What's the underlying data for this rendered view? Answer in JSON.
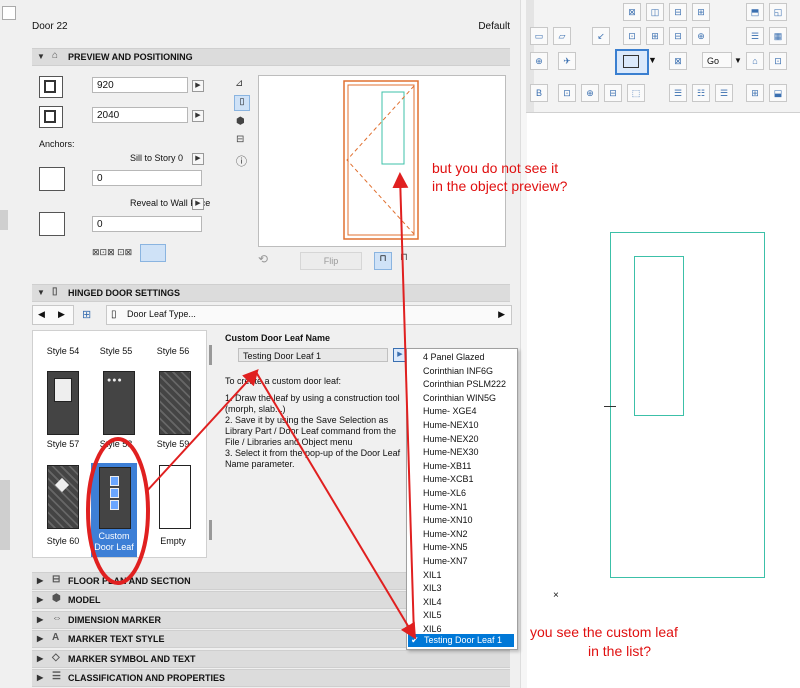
{
  "window": {
    "title": "Door 22",
    "default_label": "Default"
  },
  "preview_section": {
    "title": "PREVIEW AND POSITIONING",
    "width_value": "920",
    "height_value": "2040",
    "anchors_label": "Anchors:",
    "sill_label": "Sill to Story 0",
    "sill_value": "0",
    "reveal_label": "Reveal to Wall Face",
    "reveal_value": "0",
    "flip_label": "Flip"
  },
  "hinged_section": {
    "title": "HINGED DOOR SETTINGS",
    "dropdown_label": "Door Leaf Type...",
    "tiles": [
      {
        "label": "Style 54"
      },
      {
        "label": "Style 55"
      },
      {
        "label": "Style 56"
      },
      {
        "label": "Style 57"
      },
      {
        "label": "Style 58"
      },
      {
        "label": "Style 59"
      },
      {
        "label": "Style 60"
      },
      {
        "label": "Custom Door Leaf"
      },
      {
        "label": "Empty"
      }
    ],
    "custom_leaf_heading": "Custom Door Leaf Name",
    "custom_leaf_value": "Testing Door Leaf 1",
    "instructions": [
      "To create a custom door leaf:",
      "1. Draw the leaf by using a construction tool (morph, slab...)",
      "2. Save it by using the Save Selection as Library Part / Door Leaf command from the File / Libraries and Object menu",
      "3. Select it from the pop-up of the Door Leaf Name parameter."
    ]
  },
  "collapsed_sections": [
    {
      "title": "FLOOR PLAN AND SECTION"
    },
    {
      "title": "MODEL"
    },
    {
      "title": "DIMENSION MARKER"
    },
    {
      "title": "MARKER TEXT STYLE"
    },
    {
      "title": "MARKER SYMBOL AND TEXT"
    },
    {
      "title": "CLASSIFICATION AND PROPERTIES"
    }
  ],
  "popup_list": {
    "items": [
      "4 Panel Glazed",
      "Corinthian INF6G",
      "Corinthian PSLM222",
      "Corinthian WIN5G",
      "Hume- XGE4",
      "Hume-NEX10",
      "Hume-NEX20",
      "Hume-NEX30",
      "Hume-XB11",
      "Hume-XCB1",
      "Hume-XL6",
      "Hume-XN1",
      "Hume-XN10",
      "Hume-XN2",
      "Hume-XN5",
      "Hume-XN7",
      "XIL1",
      "XIL3",
      "XIL4",
      "XIL5",
      "XIL6"
    ],
    "selected": "Testing Door Leaf 1"
  },
  "toolbar": {
    "go_label": "Go"
  },
  "annotations": {
    "note1_line1": "but you do not see it",
    "note1_line2": "in the object preview?",
    "note2_line1": "you see the custom leaf",
    "note2_line2": "in the list?"
  },
  "colors": {
    "accent": "#e02020",
    "selection": "#0078d7",
    "drawing": "#3cc0a8",
    "door_frame": "#e07030"
  }
}
